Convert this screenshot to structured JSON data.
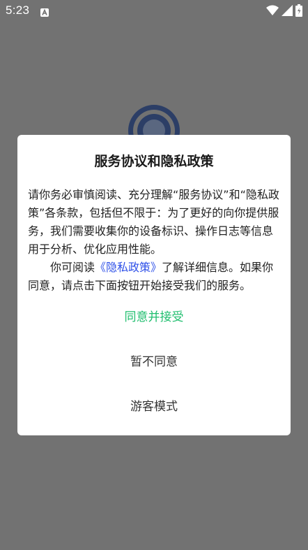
{
  "status_bar": {
    "time": "5:23",
    "icons": [
      "app-notification-icon",
      "wifi-icon",
      "cell-signal-icon",
      "battery-icon"
    ]
  },
  "colors": {
    "overlay_background": "#727272",
    "dialog_background": "#ffffff",
    "agree_text": "#1fbe6e",
    "link_text": "#2f51e8",
    "body_text": "#222222",
    "logo_ring": "#2c3e66"
  },
  "dialog": {
    "title": "服务协议和隐私政策",
    "paragraph1": "请你务必审慎阅读、充分理解“服务协议”和“隐私政策”各条款，包括但不限于：为了更好的向你提供服务，我们需要收集你的设备标识、操作日志等信息用于分析、优化应用性能。",
    "paragraph2_before": "你可阅读",
    "paragraph2_link": "《隐私政策》",
    "paragraph2_after": "了解详细信息。如果你同意，请点击下面按钮开始接受我们的服务。",
    "agree_label": "同意并接受",
    "disagree_label": "暂不同意",
    "guest_label": "游客模式"
  }
}
